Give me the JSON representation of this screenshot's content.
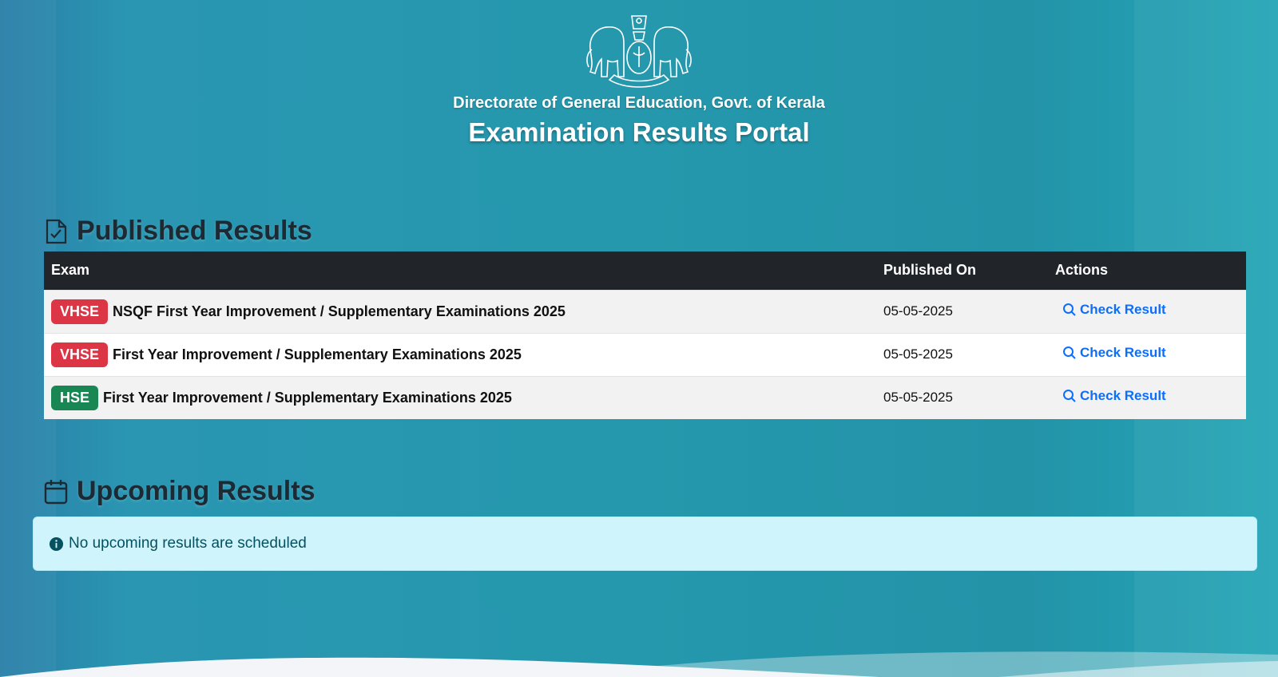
{
  "header": {
    "department": "Directorate of General Education, Govt. of Kerala",
    "portal_title": "Examination Results Portal",
    "emblem_icon": "kerala-emblem-icon"
  },
  "published": {
    "title": "Published Results",
    "icon": "file-check-icon",
    "columns": [
      "Exam",
      "Published On",
      "Actions"
    ],
    "rows": [
      {
        "badge": "VHSE",
        "badge_color": "#dc3545",
        "exam": "NSQF First Year Improvement / Supplementary Examinations 2025",
        "date": "05-05-2025",
        "action": "Check Result"
      },
      {
        "badge": "VHSE",
        "badge_color": "#dc3545",
        "exam": "First Year Improvement / Supplementary Examinations 2025",
        "date": "05-05-2025",
        "action": "Check Result"
      },
      {
        "badge": "HSE",
        "badge_color": "#198754",
        "exam": "First Year Improvement / Supplementary Examinations 2025",
        "date": "05-05-2025",
        "action": "Check Result"
      }
    ]
  },
  "upcoming": {
    "title": "Upcoming Results",
    "icon": "calendar-icon",
    "message": "No upcoming results are scheduled",
    "message_icon": "info-icon"
  },
  "colors": {
    "background": "#2598ad",
    "table_header": "#212529",
    "link": "#0d6efd",
    "alert_bg": "#cff4fc"
  }
}
